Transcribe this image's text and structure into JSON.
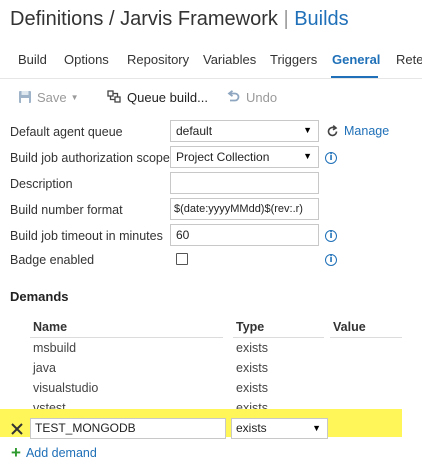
{
  "header": {
    "definitions": "Definitions",
    "sep1": "/",
    "framework": "Jarvis Framework",
    "sep2": "|",
    "builds": "Builds"
  },
  "tabs": [
    {
      "label": "Build"
    },
    {
      "label": "Options"
    },
    {
      "label": "Repository"
    },
    {
      "label": "Variables"
    },
    {
      "label": "Triggers"
    },
    {
      "label": "General",
      "active": true
    },
    {
      "label": "Reter"
    }
  ],
  "toolbar": {
    "save": "Save",
    "queue_build": "Queue build...",
    "undo": "Undo"
  },
  "form": {
    "default_agent_queue": {
      "label": "Default agent queue",
      "value": "default"
    },
    "manage": "Manage",
    "auth_scope": {
      "label": "Build job authorization scope",
      "value": "Project Collection"
    },
    "description": {
      "label": "Description",
      "value": ""
    },
    "number_format": {
      "label": "Build number format",
      "value": "$(date:yyyyMMdd)$(rev:.r)"
    },
    "timeout": {
      "label": "Build job timeout in minutes",
      "value": "60"
    },
    "badge": {
      "label": "Badge enabled",
      "checked": false
    }
  },
  "demands": {
    "title": "Demands",
    "headers": {
      "name": "Name",
      "type": "Type",
      "value": "Value"
    },
    "rows": [
      {
        "name": "msbuild",
        "type": "exists"
      },
      {
        "name": "java",
        "type": "exists"
      },
      {
        "name": "visualstudio",
        "type": "exists"
      },
      {
        "name": "vstest",
        "type": "exists"
      }
    ],
    "editing": {
      "name": "TEST_MONGODB",
      "type": "exists"
    },
    "add_label": "Add demand"
  },
  "colors": {
    "accent": "#1f70b8",
    "highlight": "#fff75a",
    "add_green": "#2e9a2e"
  },
  "icons": [
    "save-icon",
    "queue-build-icon",
    "undo-icon",
    "refresh-icon",
    "info-icon",
    "remove-icon",
    "plus-icon",
    "dropdown-caret-icon"
  ]
}
